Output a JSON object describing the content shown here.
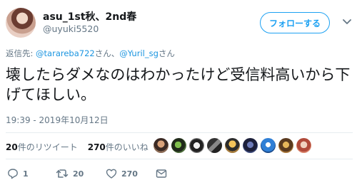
{
  "user": {
    "display_name": "asu_1st秋、2nd春",
    "handle": "@uyuki5520"
  },
  "follow_button": {
    "label": "フォローする"
  },
  "reply": {
    "prefix": "返信先: ",
    "mention1": "@tarareba722",
    "sep": "さん、",
    "mention2": "@Yuril_sg",
    "suffix": "さん"
  },
  "tweet": {
    "text": "壊したらダメなのはわかったけど受信料高いから下げてほしい。",
    "timestamp": "19:39 - 2019年10月12日"
  },
  "stats": {
    "retweets_count": "20",
    "retweets_label": "件のリツイート",
    "likes_count": "270",
    "likes_label": "件のいいね"
  },
  "likers": [
    "avatar-1",
    "avatar-2",
    "avatar-3",
    "avatar-4",
    "avatar-5",
    "avatar-6",
    "avatar-7",
    "avatar-8",
    "avatar-9"
  ],
  "actions": {
    "replies": "1",
    "retweets": "20",
    "likes": "270"
  },
  "colors": {
    "accent": "#1da1f2",
    "mention": "#1b95e0",
    "muted": "#657786",
    "text": "#14171a"
  }
}
